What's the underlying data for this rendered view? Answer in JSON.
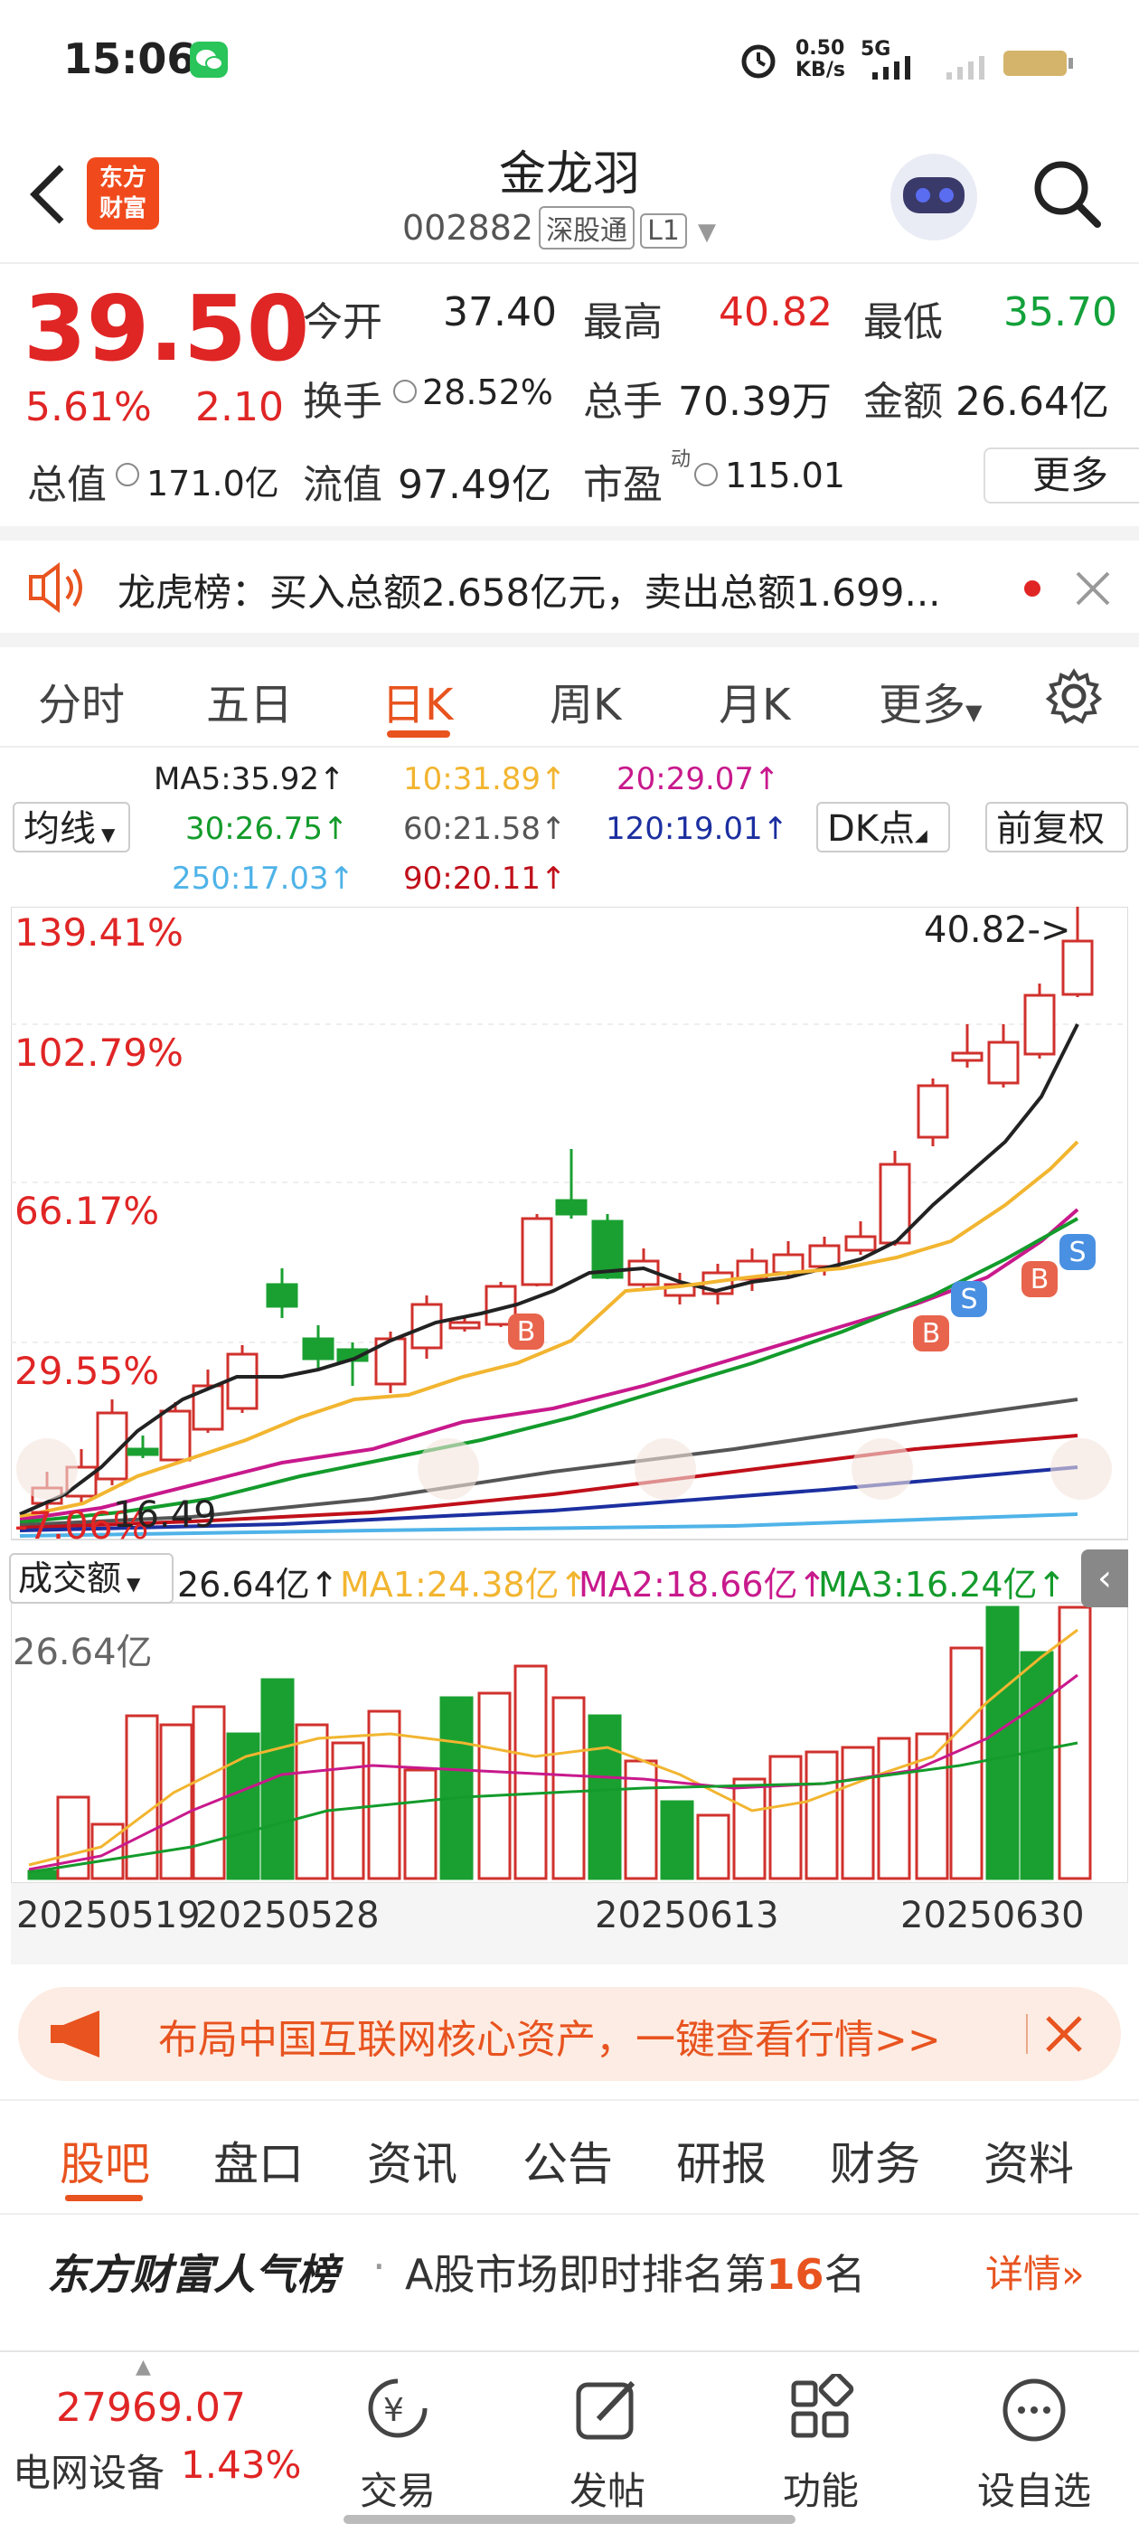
{
  "status_bar": {
    "time": "15:06",
    "net_speed": "0.50",
    "net_unit": "KB/s",
    "network": "5G"
  },
  "header": {
    "title": "金龙羽",
    "code": "002882",
    "tag1": "深股通",
    "tag2": "L1",
    "logo_line1": "东方",
    "logo_line2": "财富"
  },
  "quote": {
    "price": "39.50",
    "change_pct": "5.61%",
    "change": "2.10",
    "rows": [
      [
        {
          "label": "今开",
          "value": "37.40",
          "color": "#222"
        },
        {
          "label": "最高",
          "value": "40.82",
          "color": "#e02525"
        },
        {
          "label": "最低",
          "value": "35.70",
          "color": "#13a13a"
        }
      ],
      [
        {
          "label": "换手",
          "value": "28.52%",
          "color": "#222"
        },
        {
          "label": "总手",
          "value": "70.39万",
          "color": "#222"
        },
        {
          "label": "金额",
          "value": "26.64亿",
          "color": "#222"
        }
      ],
      [
        {
          "label": "总值",
          "value": "171.0亿",
          "color": "#222"
        },
        {
          "label": "流值",
          "value": "97.49亿",
          "color": "#222"
        },
        {
          "label": "市盈",
          "value": "115.01",
          "color": "#222"
        }
      ]
    ],
    "pe_sup": "动",
    "more_label": "更多"
  },
  "notice": {
    "text": "龙虎榜：买入总额2.658亿元，卖出总额1.699..."
  },
  "kline_tabs": [
    "分时",
    "五日",
    "日K",
    "周K",
    "月K",
    "更多"
  ],
  "active_tab": "日K",
  "ma_legend": {
    "ma5": "MA5:35.92↑",
    "ma10": "10:31.89↑",
    "ma20": "20:29.07↑",
    "ma30": "30:26.75↑",
    "ma60": "60:21.58↑",
    "ma120": "120:19.01↑",
    "ma250": "250:17.03↑",
    "ma90": "90:20.11↑",
    "colors": {
      "ma5": "#222222",
      "ma10": "#f2b530",
      "ma20": "#c8198c",
      "ma30": "#139b2b",
      "ma60": "#555555",
      "ma120": "#1c2fa0",
      "ma250": "#4fb3e8",
      "ma90": "#c0101a"
    },
    "avg_line_label": "均线",
    "dk_label": "DK点",
    "adjust_label": "前复权"
  },
  "chart_data": {
    "type": "candlestick",
    "y_axis_labels": [
      "139.41%",
      "102.79%",
      "66.17%",
      "29.55%",
      "-7.06%"
    ],
    "high_marker": "40.82->",
    "low_marker": "16.49",
    "signal_labels": [
      "S",
      "B",
      "B",
      "S",
      "S"
    ],
    "dates": [
      "20250519",
      "20250528",
      "20250613",
      "20250630"
    ],
    "volume_legend": {
      "main": "成交额",
      "amount": "26.64亿↑",
      "ma1": "MA1:24.38亿↑",
      "ma2": "MA2:18.66亿↑",
      "ma3": "MA3:16.24亿↑",
      "axis_max": "26.64亿"
    }
  },
  "banner": {
    "text": "布局中国互联网核心资产，一键查看行情>>"
  },
  "bottom_tabs": [
    "股吧",
    "盘口",
    "资讯",
    "公告",
    "研报",
    "财务",
    "资料"
  ],
  "rank": {
    "brand": "东方财富人气榜",
    "text_pre": "A股市场即时排名第",
    "rank_no": "16",
    "text_post": "名",
    "detail": "详情"
  },
  "nav": {
    "index_value": "27969.07",
    "index_name": "电网设备",
    "index_pct": "1.43%",
    "items": [
      "交易",
      "发帖",
      "功能",
      "设自选"
    ]
  }
}
